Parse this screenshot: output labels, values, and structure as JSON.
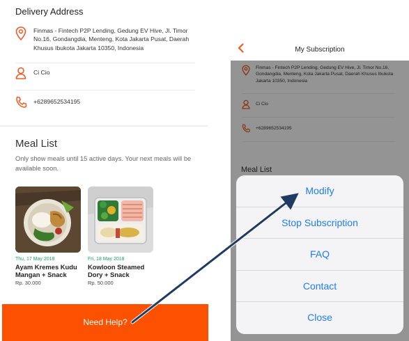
{
  "left": {
    "section_title": "Delivery Address",
    "address": "Finmas - Fintech P2P Lending, Gedung EV Hive, Jl. Timor No.16, Gondangdia, Menteng, Kota Jakarta Pusat, Daerah Khusus Ibukota Jakarta 10350, Indonesia",
    "name": "Ci Cio",
    "phone": "+6289652534195",
    "meal_title": "Meal List",
    "meal_desc": "Only show meals until 15 active days. Your next meals will be available soon.",
    "meals": [
      {
        "date": "Thu, 17 May 2018",
        "name": "Ayam Kremes Kudu Mangan + Snack",
        "price": "Rp. 30.000"
      },
      {
        "date": "Fri, 18 May 2018",
        "name": "Kowloon Steamed Dory + Snack",
        "price": "Rp. 50.000"
      }
    ],
    "help_label": "Need Help?"
  },
  "right": {
    "title": "My Subscription",
    "address": "Finmas - Fintech P2P Lending, Gedung EV Hive, Jl. Timor No.16, Gondangdia, Menteng, Kota Jakarta Pusat, Daerah Khusus Ibukota Jakarta 10350, Indonesia",
    "name": "Ci Cio",
    "phone": "+6289652534195",
    "meal_title": "Meal List",
    "options": [
      "Modify",
      "Stop Subscription",
      "FAQ",
      "Contact",
      "Close"
    ]
  },
  "icons": {
    "location": "location-pin-icon",
    "person": "person-icon",
    "phone": "phone-icon",
    "back": "chevron-left-icon"
  },
  "colors": {
    "brand_orange": "#fc5100",
    "action_blue": "#1f7cf2",
    "date_green": "#1aa36b",
    "arrow_navy": "#1f3a63"
  }
}
